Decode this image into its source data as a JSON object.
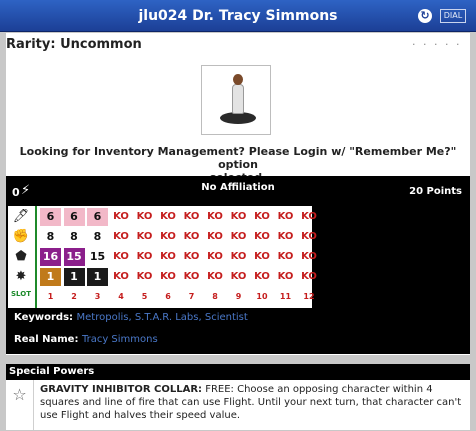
{
  "title": "jlu024 Dr. Tracy Simmons",
  "title_icons": {
    "rotate": "rotate-icon",
    "dial_label": "DIAL"
  },
  "rarity": "Rarity: Uncommon",
  "dots": "· · · · ·",
  "login_line1": "Looking for Inventory Management? Please Login w/ \"Remember Me?\" option",
  "login_line2": "selected.",
  "dial": {
    "zero_label": "0",
    "affiliation": "No Affiliation",
    "points": "20 Points",
    "slot_label": "SLOT",
    "speed": [
      "6",
      "6",
      "6",
      "KO",
      "KO",
      "KO",
      "KO",
      "KO",
      "KO",
      "KO",
      "KO",
      "KO"
    ],
    "attack": [
      "8",
      "8",
      "8",
      "KO",
      "KO",
      "KO",
      "KO",
      "KO",
      "KO",
      "KO",
      "KO",
      "KO"
    ],
    "defense": [
      "16",
      "15",
      "15",
      "KO",
      "KO",
      "KO",
      "KO",
      "KO",
      "KO",
      "KO",
      "KO",
      "KO"
    ],
    "damage": [
      "1",
      "1",
      "1",
      "KO",
      "KO",
      "KO",
      "KO",
      "KO",
      "KO",
      "KO",
      "KO",
      "KO"
    ],
    "slots": [
      "1",
      "2",
      "3",
      "4",
      "5",
      "6",
      "7",
      "8",
      "9",
      "10",
      "11",
      "12"
    ]
  },
  "keywords_label": "Keywords:",
  "keywords": "Metropolis, S.T.A.R. Labs, Scientist",
  "realname_label": "Real Name:",
  "realname": "Tracy Simmons",
  "special_powers_title": "Special Powers",
  "power_name": "GRAVITY INHIBITOR COLLAR:",
  "power_text": "FREE: Choose an opposing character within 4 squares and line of fire that can use Flight. Until your next turn, that character can't use Flight and halves their speed value.",
  "colors": {
    "title_bar": "#2e63c4",
    "ko": "#c51d1d",
    "slot_green": "#1f8a2a",
    "link": "#4a78c8"
  }
}
